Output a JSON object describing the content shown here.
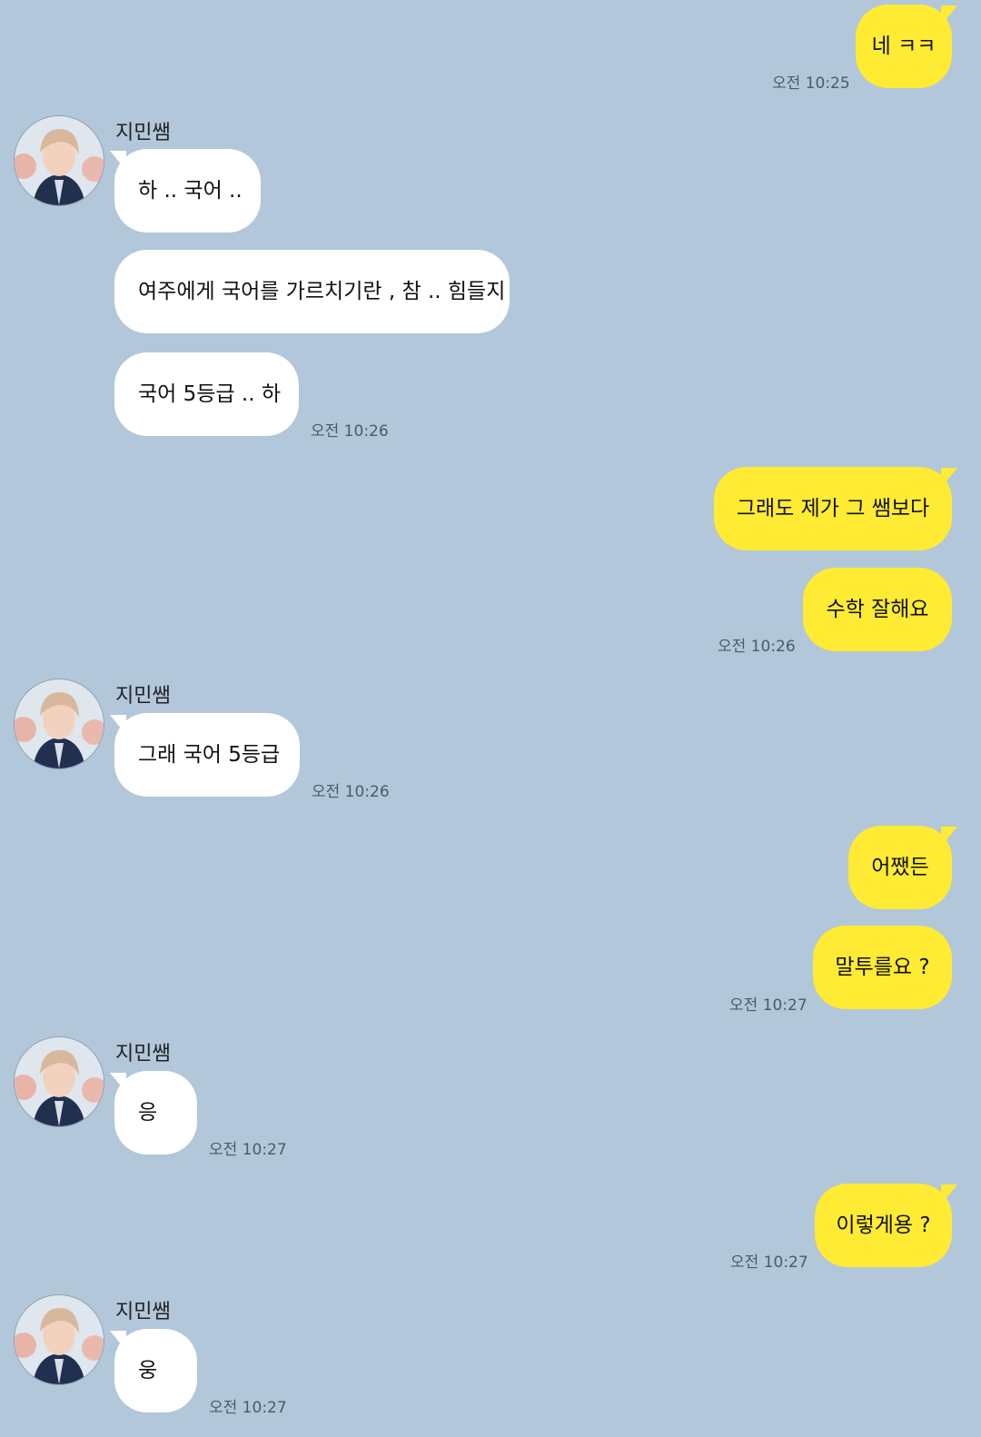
{
  "contact": {
    "name": "지민쌤"
  },
  "colors": {
    "background": "#b2c7d9",
    "my_bubble": "#ffeb33",
    "their_bubble": "#ffffff"
  },
  "messages": [
    {
      "from": "me",
      "text": "네 ㅋㅋ",
      "time": "오전 10:25"
    },
    {
      "from": "them",
      "text": "하 .. 국어 ..",
      "time": ""
    },
    {
      "from": "them",
      "text": "여주에게 국어를 가르치기란 , 참 .. 힘들지",
      "time": ""
    },
    {
      "from": "them",
      "text": "국어 5등급 .. 하",
      "time": "오전 10:26"
    },
    {
      "from": "me",
      "text": "그래도 제가 그 쌤보다",
      "time": ""
    },
    {
      "from": "me",
      "text": "수학 잘해요",
      "time": "오전 10:26"
    },
    {
      "from": "them",
      "text": "그래 국어 5등급",
      "time": "오전 10:26"
    },
    {
      "from": "me",
      "text": "어쨌든",
      "time": ""
    },
    {
      "from": "me",
      "text": "말투를요 ?",
      "time": "오전 10:27"
    },
    {
      "from": "them",
      "text": "응",
      "time": "오전 10:27"
    },
    {
      "from": "me",
      "text": "이렇게용 ?",
      "time": "오전 10:27"
    },
    {
      "from": "them",
      "text": "웅",
      "time": "오전 10:27"
    }
  ]
}
